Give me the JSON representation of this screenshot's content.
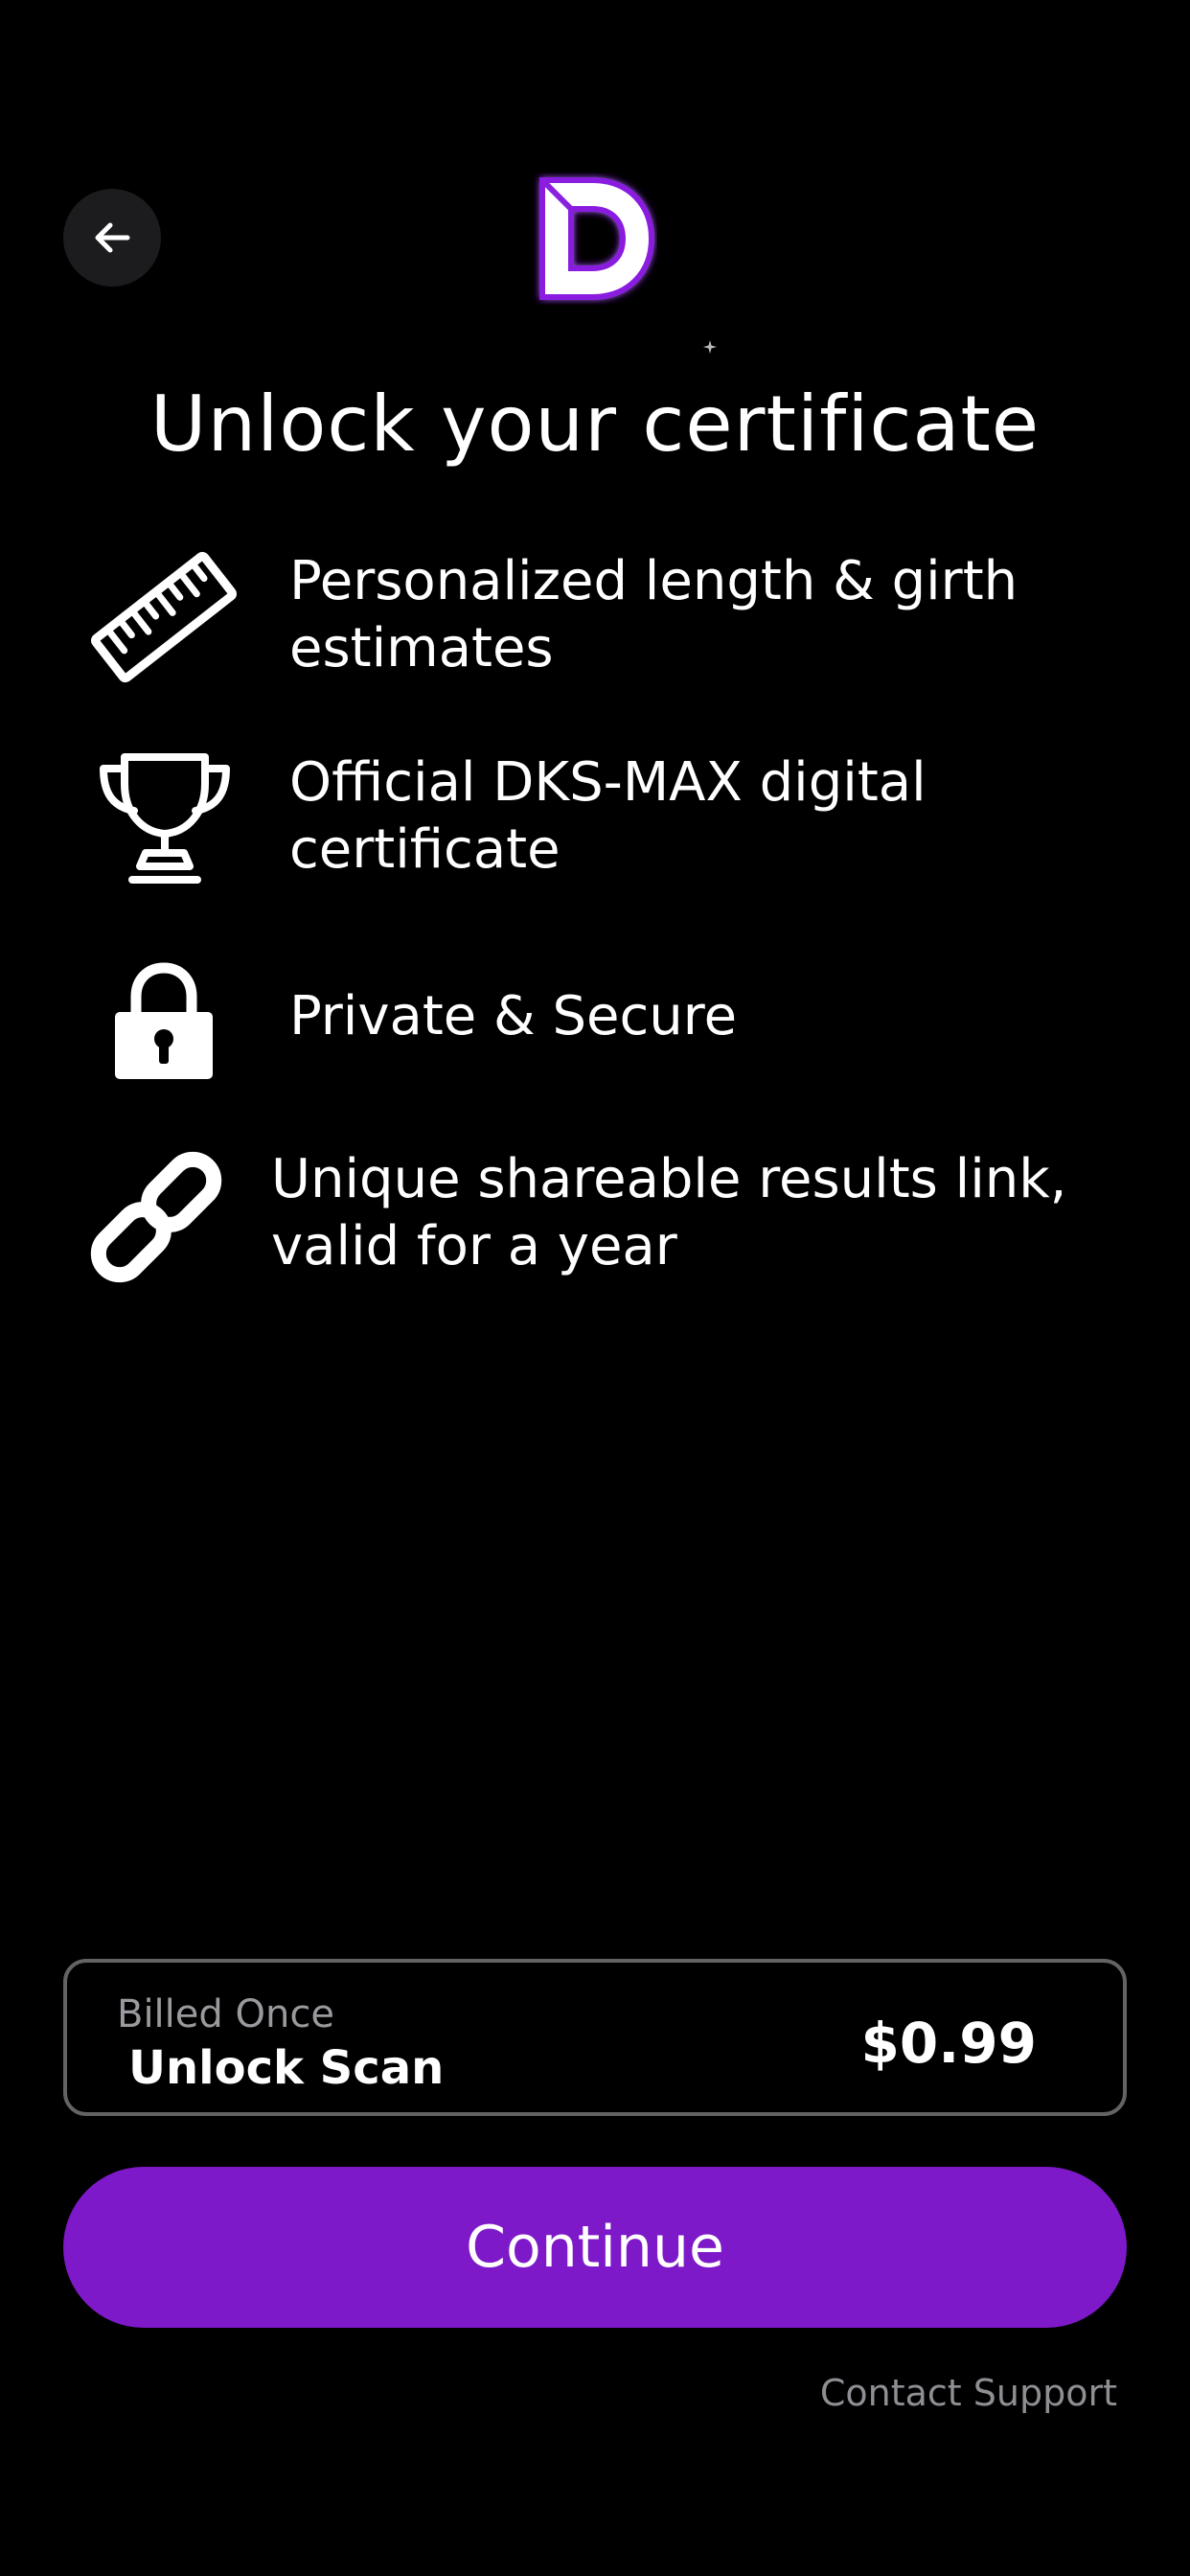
{
  "header": {
    "back_icon": "arrow-left-icon",
    "logo_icon": "d-logo-icon",
    "accent_color": "#7d19c8"
  },
  "title": "Unlock your certificate",
  "features": [
    {
      "icon": "ruler-icon",
      "text_line1": "Personalized length & girth",
      "text_line2": "estimates"
    },
    {
      "icon": "trophy-icon",
      "text_line1": "Official DKS-MAX digital",
      "text_line2": "certificate"
    },
    {
      "icon": "lock-icon",
      "text_line1": "Private & Secure",
      "text_line2": ""
    },
    {
      "icon": "link-icon",
      "text_line1": "Unique shareable results link,",
      "text_line2": "valid for a year"
    }
  ],
  "plan": {
    "billing": "Billed Once",
    "name": "Unlock Scan",
    "price": "$0.99"
  },
  "continue_label": "Continue",
  "contact_support_label": "Contact Support"
}
